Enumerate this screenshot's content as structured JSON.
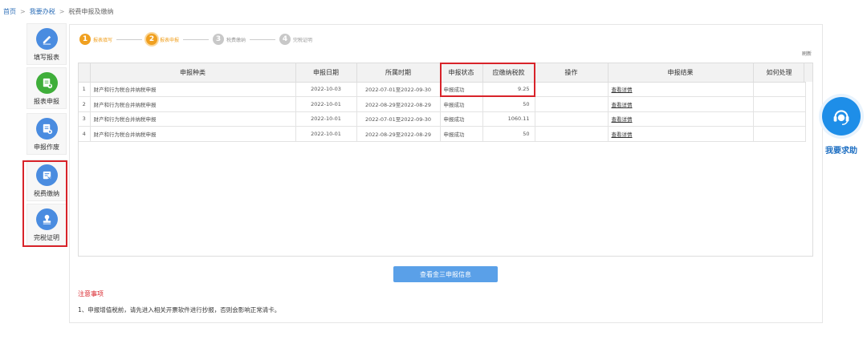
{
  "breadcrumb": {
    "home": "首页",
    "sep1": ">",
    "section": "我要办税",
    "sep2": ">",
    "current": "税费申报及缴纳"
  },
  "sidebar": {
    "items": [
      {
        "label": "填写报表",
        "icon": "pencil-icon"
      },
      {
        "label": "报表申报",
        "icon": "document-upload-icon"
      },
      {
        "label": "申报作废",
        "icon": "document-cancel-icon"
      },
      {
        "label": "税费缴纳",
        "icon": "payment-icon"
      },
      {
        "label": "完税证明",
        "icon": "stamp-icon"
      }
    ]
  },
  "steps": [
    {
      "num": "1",
      "label": "报表填写"
    },
    {
      "num": "2",
      "label": "报表申报"
    },
    {
      "num": "3",
      "label": "税费缴纳"
    },
    {
      "num": "4",
      "label": "完税证明"
    }
  ],
  "refresh_label": "刷新",
  "table": {
    "headers": [
      "",
      "申报种类",
      "申报日期",
      "所属时期",
      "申报状态",
      "应缴纳税款",
      "操作",
      "申报结果",
      "如何处理"
    ],
    "rows": [
      {
        "idx": "1",
        "type": "财产和行为税合并纳税申报",
        "date": "2022-10-03",
        "period": "2022-07-01至2022-09-30",
        "status": "申报成功",
        "amount": "9.25",
        "op": "",
        "result": "查看详情",
        "handle": ""
      },
      {
        "idx": "2",
        "type": "财产和行为税合并纳税申报",
        "date": "2022-10-01",
        "period": "2022-08-29至2022-08-29",
        "status": "申报成功",
        "amount": "50",
        "op": "",
        "result": "查看详情",
        "handle": ""
      },
      {
        "idx": "3",
        "type": "财产和行为税合并纳税申报",
        "date": "2022-10-01",
        "period": "2022-07-01至2022-09-30",
        "status": "申报成功",
        "amount": "1060.11",
        "op": "",
        "result": "查看详情",
        "handle": ""
      },
      {
        "idx": "4",
        "type": "财产和行为税合并纳税申报",
        "date": "2022-10-01",
        "period": "2022-08-29至2022-08-29",
        "status": "申报成功",
        "amount": "50",
        "op": "",
        "result": "查看详情",
        "handle": ""
      }
    ]
  },
  "main_button": "查看金三申报信息",
  "notes": {
    "title": "注意事项",
    "line1": "1、申报增值税前，请先进入相关开票软件进行抄报，否则会影响正常清卡。"
  },
  "help": {
    "label": "我要求助",
    "icon": "customer-service-icon"
  },
  "colors": {
    "accent": "#4a8ce0",
    "step_active": "#f0a020",
    "highlight": "#d8232a",
    "button": "#5aa0e8"
  }
}
